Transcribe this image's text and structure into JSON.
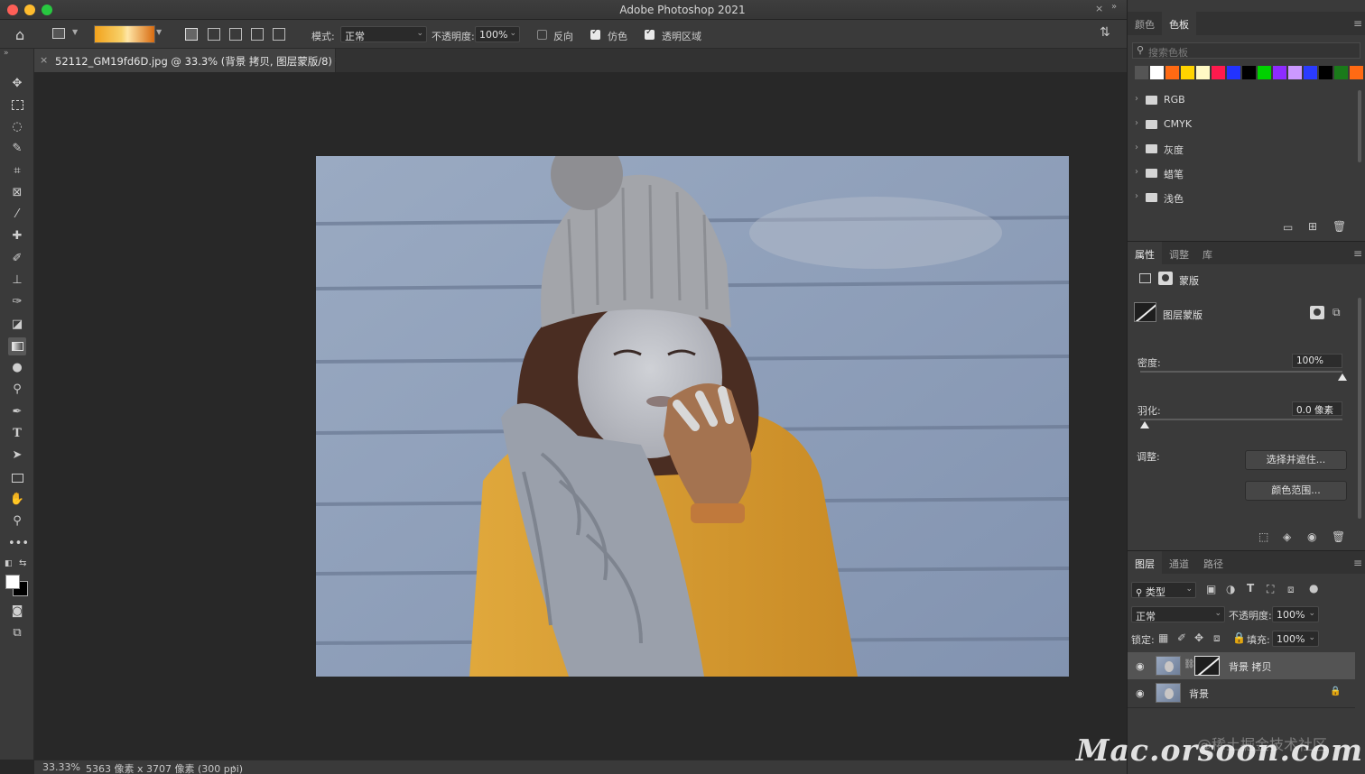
{
  "window": {
    "title": "Adobe Photoshop 2021"
  },
  "options_bar": {
    "mode_label": "模式:",
    "mode_value": "正常",
    "opacity_label": "不透明度:",
    "opacity_value": "100%",
    "reverse_label": "反向",
    "reverse_checked": false,
    "dither_label": "仿色",
    "dither_checked": true,
    "transparency_label": "透明区域",
    "transparency_checked": true
  },
  "tools": [
    "move-icon",
    "marquee-icon",
    "lasso-icon",
    "quick-select-icon",
    "crop-icon",
    "frame-icon",
    "eyedropper-icon",
    "healing-icon",
    "brush-icon",
    "stamp-icon",
    "history-brush-icon",
    "eraser-icon",
    "gradient-icon",
    "blur-icon",
    "dodge-icon",
    "pen-icon",
    "type-icon",
    "path-select-icon",
    "rectangle-icon",
    "hand-icon",
    "zoom-icon",
    "more-icon"
  ],
  "document": {
    "tab_title": "52112_GM19fd6D.jpg @ 33.3% (背景 拷贝, 图层蒙版/8) *",
    "close_glyph": "×"
  },
  "status_bar": {
    "zoom": "33.33%",
    "info": "5363 像素 x 3707 像素 (300 ppi)",
    "arrow": "›"
  },
  "swatches_panel": {
    "tabs": [
      "颜色",
      "色板"
    ],
    "active_tab": "色板",
    "search_placeholder": "搜索色板",
    "colors": [
      "#ffffff",
      "#ff6a13",
      "#ffd400",
      "#fff9c4",
      "#ff1a4d",
      "#2233ff",
      "#000000",
      "#00d200",
      "#8d2bff",
      "#cc99ff",
      "#2a3bff",
      "#000000",
      "#1a7a1a",
      "#ff6a13"
    ],
    "folders": [
      "RGB",
      "CMYK",
      "灰度",
      "蜡笔",
      "浅色"
    ]
  },
  "properties_panel": {
    "tabs": [
      "属性",
      "调整",
      "库"
    ],
    "active_tab": "属性",
    "mask_label": "蒙版",
    "layer_mask_label": "图层蒙版",
    "density_label": "密度:",
    "density_value": "100%",
    "density_level": 1.0,
    "feather_label": "羽化:",
    "feather_value": "0.0 像素",
    "feather_level": 0.0,
    "adjust_label": "调整:",
    "select_mask_button": "选择并遮住...",
    "color_range_button": "颜色范围..."
  },
  "layers_panel": {
    "tabs": [
      "图层",
      "通道",
      "路径"
    ],
    "active_tab": "图层",
    "filter_label": "类型",
    "blend_mode": "正常",
    "opacity_label": "不透明度:",
    "opacity_value": "100%",
    "lock_label": "锁定:",
    "fill_label": "填充:",
    "fill_value": "100%",
    "layers": [
      {
        "name": "背景 拷贝",
        "selected": true,
        "has_mask": true,
        "locked": false
      },
      {
        "name": "背景",
        "selected": false,
        "has_mask": false,
        "locked": true
      }
    ]
  },
  "watermark": {
    "brand": "Mac.orsoon.com",
    "community": "@稀土掘金技术社区"
  }
}
